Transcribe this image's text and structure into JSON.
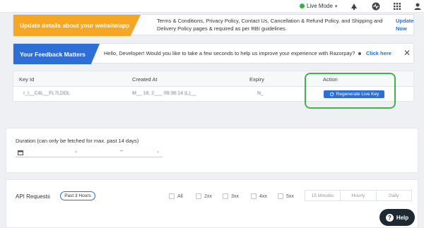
{
  "topbar": {
    "mode_label": "Live Mode",
    "mode_caret": "▾",
    "icons": [
      "announcement-icon",
      "activity-icon",
      "apps-grid-icon",
      "user-icon"
    ]
  },
  "banner_update": {
    "tag": "Update details about your website/app",
    "text": "Terms & Conditions, Privacy Policy, Contact Us, Cancellation & Refund Policy, and Shipping and Delivery Policy pages & required as per RBI guidelines.",
    "link": "Update Now"
  },
  "banner_feedback": {
    "tag": "Your Feedback Matters",
    "text": "Hello, Developer! Would you like to take a few seconds to help us improve your experience with Razorpay?",
    "link": "Click here",
    "close": "✕"
  },
  "keys_table": {
    "headers": [
      "Key Id",
      "Created At",
      "Expiry",
      "Action"
    ],
    "row": {
      "key_id": "r_l__C4L__FL7LDDL",
      "created_at": "M__ 18, 2___ 09:36:14 (L)__",
      "expiry": "N_",
      "action": "Regenerate Live Key"
    }
  },
  "duration": {
    "label": "Duration (can only be fetched for max. past 14 days)",
    "start_value": "",
    "end_value": "--",
    "caret": "⌄"
  },
  "api_requests": {
    "label": "API Requests",
    "range_pill": "Past 3 Hours",
    "filters": [
      "All",
      "2xx",
      "3xx",
      "4xx",
      "5xx"
    ],
    "granularity": [
      "15 Minutes",
      "Hourly",
      "Daily"
    ]
  },
  "help": {
    "label": "Help",
    "glyph": "?"
  },
  "colors": {
    "accent": "#2d6fd6",
    "warning": "#f6a623",
    "live": "#2fb344",
    "highlight": "#3db34a"
  }
}
